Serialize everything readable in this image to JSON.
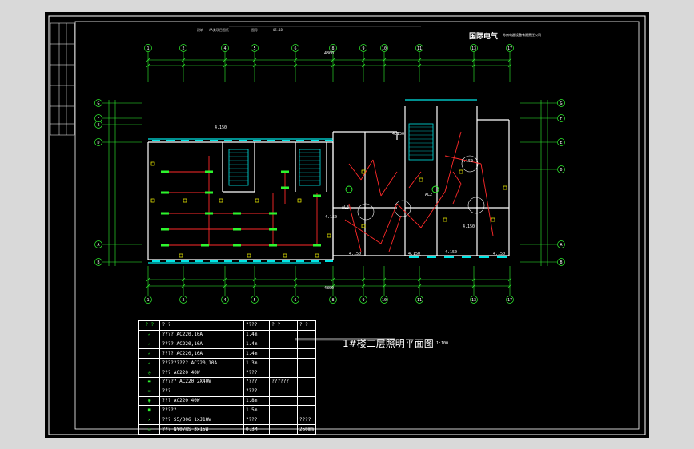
{
  "header": {
    "items": [
      "建筑",
      "AA类项目图纸",
      "图号",
      "05.1D"
    ],
    "logo": "国际电气",
    "company": "苏州电器设备有限责任公司"
  },
  "plan": {
    "title": "1#楼二层照明平面图",
    "scale": "1:100",
    "axis_top": [
      "1",
      "2",
      "4",
      "5",
      "6",
      "8",
      "9",
      "10",
      "11",
      "13",
      "17"
    ],
    "axis_bottom": [
      "1",
      "2",
      "4",
      "5",
      "6",
      "8",
      "9",
      "10",
      "11",
      "13",
      "17"
    ],
    "axis_left": [
      "G",
      "F",
      "E",
      "D",
      "A",
      "B"
    ],
    "axis_right": [
      "G",
      "F",
      "E",
      "D",
      "A",
      "B"
    ],
    "overall_dim": "4800",
    "room_labels": [
      "4.150",
      "4.150",
      "4.150",
      "4.150",
      "4.150",
      "4.150",
      "4.150",
      "AL3",
      "AL2",
      "4.150",
      "4.150"
    ]
  },
  "legend": {
    "headers": [
      "? ?",
      "? ?",
      "????",
      "? ?",
      "? ?"
    ],
    "rows": [
      {
        "icon": "switch-single-icon",
        "name": "????  AC220,10A",
        "c3": "1.4m",
        "c4": "",
        "c5": ""
      },
      {
        "icon": "switch-double-icon",
        "name": "????  AC220,10A",
        "c3": "1.4m",
        "c4": "",
        "c5": ""
      },
      {
        "icon": "switch-triple-icon",
        "name": "????  AC220,10A",
        "c3": "1.4m",
        "c4": "",
        "c5": ""
      },
      {
        "icon": "switch-dim-icon",
        "name": "?????????    AC220,10A",
        "c3": "1.3m",
        "c4": "",
        "c5": ""
      },
      {
        "icon": "ceiling-lamp-icon",
        "name": "???    AC220  40W",
        "c3": "????",
        "c4": "",
        "c5": ""
      },
      {
        "icon": "fluorescent-lamp-icon",
        "name": "?????    AC220  2X40W",
        "c3": "????",
        "c4": "??????",
        "c5": ""
      },
      {
        "icon": "wall-lamp-icon",
        "name": "???",
        "c3": "????",
        "c4": "",
        "c5": ""
      },
      {
        "icon": "bulkhead-lamp-icon",
        "name": "???    AC220  40W",
        "c3": "1.8m",
        "c4": "",
        "c5": ""
      },
      {
        "icon": "panel-icon",
        "name": "?????",
        "c3": "1.5m",
        "c4": "",
        "c5": ""
      },
      {
        "icon": "fan-icon",
        "name": "???    S5/306 1xJ18W",
        "c3": "????",
        "c4": "",
        "c5": "????"
      },
      {
        "icon": "distribution-box-icon",
        "name": "???      NY07RS    3x15W",
        "c3": "0.3M",
        "c4": "",
        "c5": "260mm"
      }
    ]
  },
  "colors": {
    "background": "#000000",
    "page": "#d9d9d9",
    "wall": "#ffffff",
    "window": "#00e5e5",
    "axis": "#2ef52e",
    "wiring": "#ff2a2a"
  }
}
